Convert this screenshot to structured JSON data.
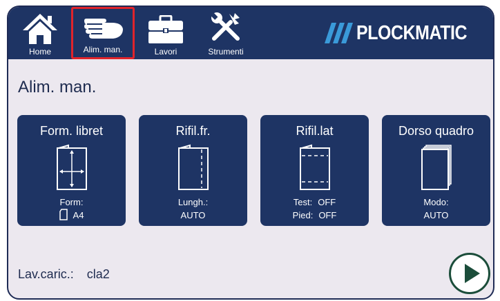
{
  "nav": {
    "items": [
      {
        "label": "Home",
        "icon": "home-icon"
      },
      {
        "label": "Alim. man.",
        "icon": "hand-icon",
        "active": true
      },
      {
        "label": "Lavori",
        "icon": "briefcase-icon"
      },
      {
        "label": "Strumenti",
        "icon": "tools-icon"
      }
    ],
    "brand": "PLOCKMATIC"
  },
  "page": {
    "title": "Alim. man."
  },
  "cards": [
    {
      "title": "Form. libret",
      "icon": "booklet-format-icon",
      "line1": "Form:",
      "line2": "A4"
    },
    {
      "title": "Rifil.fr.",
      "icon": "front-trim-icon",
      "line1": "Lungh.:",
      "line2": "AUTO"
    },
    {
      "title": "Rifil.lat",
      "icon": "side-trim-icon",
      "line1_label": "Test:",
      "line1_value": "OFF",
      "line2_label": "Pied:",
      "line2_value": "OFF"
    },
    {
      "title": "Dorso quadro",
      "icon": "square-back-icon",
      "line1": "Modo:",
      "line2": "AUTO"
    }
  ],
  "footer": {
    "label": "Lav.caric.:",
    "value": "cla2"
  },
  "colors": {
    "navy": "#1e3464",
    "active_outline": "#e0242b",
    "background": "#ece8ef",
    "play": "#1b4d3a"
  }
}
